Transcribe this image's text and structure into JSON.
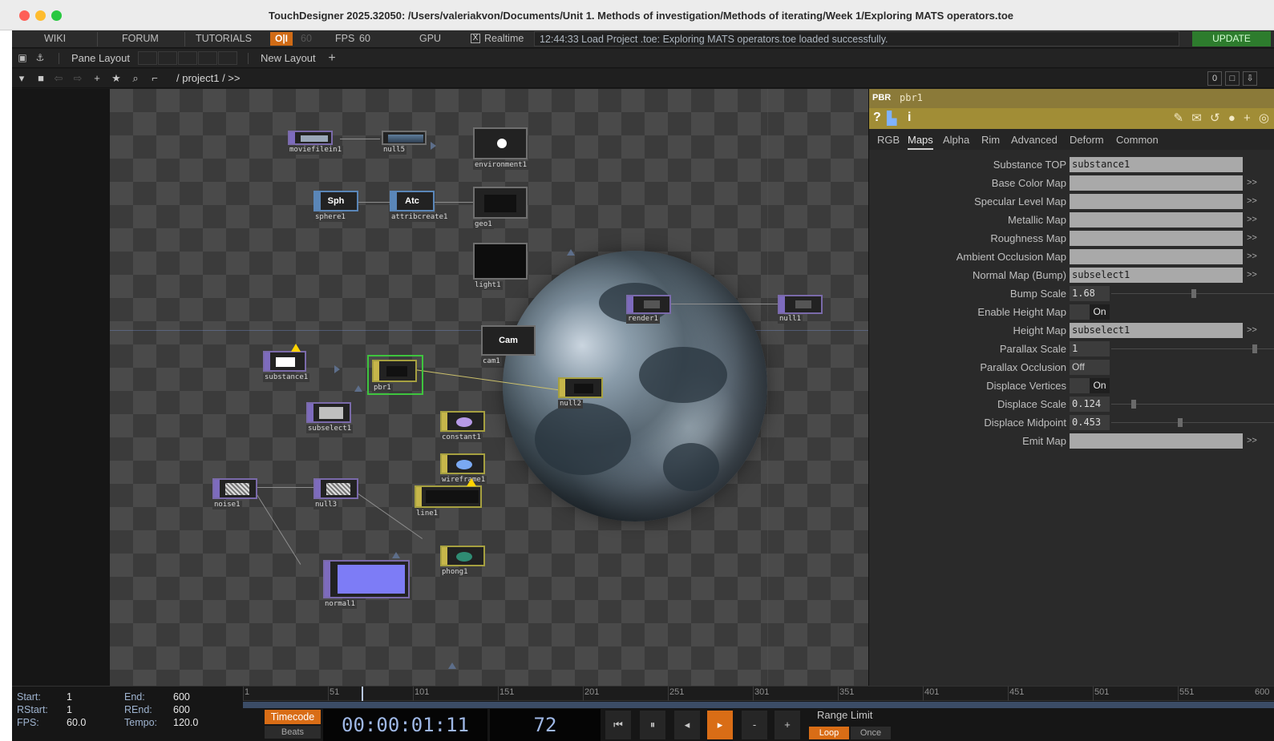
{
  "window": {
    "title": "TouchDesigner 2025.32050: /Users/valeriakvon/Documents/Unit 1. Methods of investigation/Methods of iterating/Week 1/Exploring MATS operators.toe"
  },
  "menubar": {
    "wiki": "WIKI",
    "forum": "FORUM",
    "tutorials": "TUTORIALS",
    "oi": "O|I",
    "sixty": "60",
    "fps": "FPS",
    "fps_value": "60",
    "gpu": "GPU",
    "realtime_check": "X",
    "realtime": "Realtime",
    "status": "12:44:33 Load Project .toe: Exploring MATS operators.toe loaded successfully.",
    "update": "UPDATE"
  },
  "panebar": {
    "pane_layout": "Pane Layout",
    "new_layout": "New Layout"
  },
  "pathbar": {
    "path": "/ project1 / >>",
    "right_value": "0"
  },
  "network": {
    "operators": {
      "moviefilein1": "moviefilein1",
      "null5": "null5",
      "environment1": "environment1",
      "sphere1": "sphere1",
      "sphere1_text": "Sph",
      "attribcreate1": "attribcreate1",
      "attribcreate1_text": "Atc",
      "geo1": "geo1",
      "light1": "light1",
      "render1": "render1",
      "null1": "null1",
      "cam1": "cam1",
      "cam1_text": "Cam",
      "substance1": "substance1",
      "pbr1": "pbr1",
      "null2": "null2",
      "subselect1": "subselect1",
      "constant1": "constant1",
      "wireframe1": "wireframe1",
      "noise1": "noise1",
      "null3": "null3",
      "line1": "line1",
      "phong1": "phong1",
      "normal1": "normal1"
    }
  },
  "params": {
    "type": "PBR",
    "name": "pbr1",
    "tabs": [
      "RGB",
      "Maps",
      "Alpha",
      "Rim",
      "Advanced",
      "Deform",
      "Common"
    ],
    "rows": {
      "substance_top": {
        "label": "Substance TOP",
        "value": "substance1"
      },
      "base_color": {
        "label": "Base Color Map",
        "value": ""
      },
      "specular": {
        "label": "Specular Level Map",
        "value": ""
      },
      "metallic": {
        "label": "Metallic Map",
        "value": ""
      },
      "roughness": {
        "label": "Roughness Map",
        "value": ""
      },
      "ao": {
        "label": "Ambient Occlusion Map",
        "value": ""
      },
      "normal": {
        "label": "Normal Map (Bump)",
        "value": "subselect1"
      },
      "bump_scale": {
        "label": "Bump Scale",
        "value": "1.68"
      },
      "enable_height": {
        "label": "Enable Height Map",
        "value": "On"
      },
      "height_map": {
        "label": "Height Map",
        "value": "subselect1"
      },
      "parallax_scale": {
        "label": "Parallax Scale",
        "value": "1"
      },
      "parallax_occ": {
        "label": "Parallax Occlusion",
        "value": "Off"
      },
      "displace_vertices": {
        "label": "Displace Vertices",
        "value": "On"
      },
      "displace_scale": {
        "label": "Displace Scale",
        "value": "0.124"
      },
      "displace_mid": {
        "label": "Displace Midpoint",
        "value": "0.453"
      },
      "emit_map": {
        "label": "Emit Map",
        "value": ""
      }
    },
    "more": ">>"
  },
  "timeline": {
    "start_label": "Start:",
    "start": "1",
    "end_label": "End:",
    "end": "600",
    "rstart_label": "RStart:",
    "rstart": "1",
    "rend_label": "REnd:",
    "rend": "600",
    "fps_label": "FPS:",
    "fps": "60.0",
    "tempo_label": "Tempo:",
    "tempo": "120.0",
    "ticks": [
      "1",
      "51",
      "101",
      "151",
      "201",
      "251",
      "301",
      "351",
      "401",
      "451",
      "501",
      "551",
      "600"
    ],
    "timecode_btn": "Timecode",
    "beats_btn": "Beats",
    "timecode": "00:00:01:11",
    "frame": "72",
    "range_limit": "Range Limit",
    "loop": "Loop",
    "once": "Once"
  }
}
